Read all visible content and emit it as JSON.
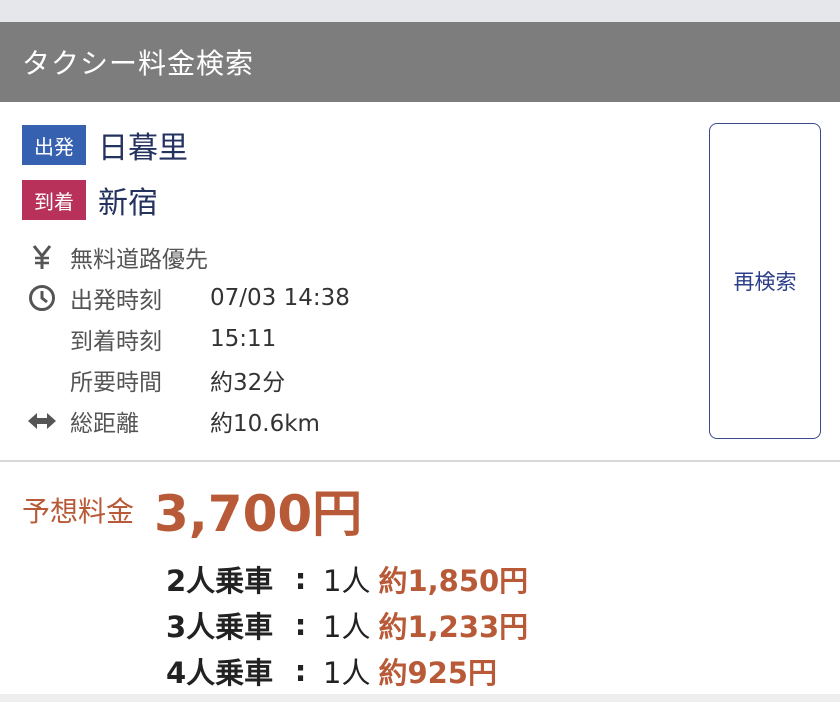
{
  "header": {
    "title": "タクシー料金検索"
  },
  "route": {
    "departure": {
      "badge": "出発",
      "station": "日暮里"
    },
    "arrival": {
      "badge": "到着",
      "station": "新宿"
    }
  },
  "details": [
    {
      "icon": "yen-icon",
      "label": "無料道路優先",
      "value": ""
    },
    {
      "icon": "clock-icon",
      "label": "出発時刻",
      "value": "07/03 14:38"
    },
    {
      "icon": "",
      "label": "到着時刻",
      "value": "15:11"
    },
    {
      "icon": "",
      "label": "所要時間",
      "value": "約32分"
    },
    {
      "icon": "distance-arrows-icon",
      "label": "総距離",
      "value": "約10.6km"
    }
  ],
  "research_button": {
    "label": "再検索"
  },
  "fare": {
    "label": "予想料金",
    "total": "3,700円",
    "shares": [
      {
        "riders": "2人乗車",
        "colon": ":",
        "per": "1人",
        "amount": "約1,850円"
      },
      {
        "riders": "3人乗車",
        "colon": ":",
        "per": "1人",
        "amount": "約1,233円"
      },
      {
        "riders": "4人乗車",
        "colon": ":",
        "per": "1人",
        "amount": "約925円"
      }
    ]
  },
  "colors": {
    "header_bg": "#7d7d7d",
    "departure_badge": "#3660b0",
    "arrival_badge": "#b8315b",
    "fare_accent": "#b85a37",
    "button_border": "#3a4a8c"
  }
}
